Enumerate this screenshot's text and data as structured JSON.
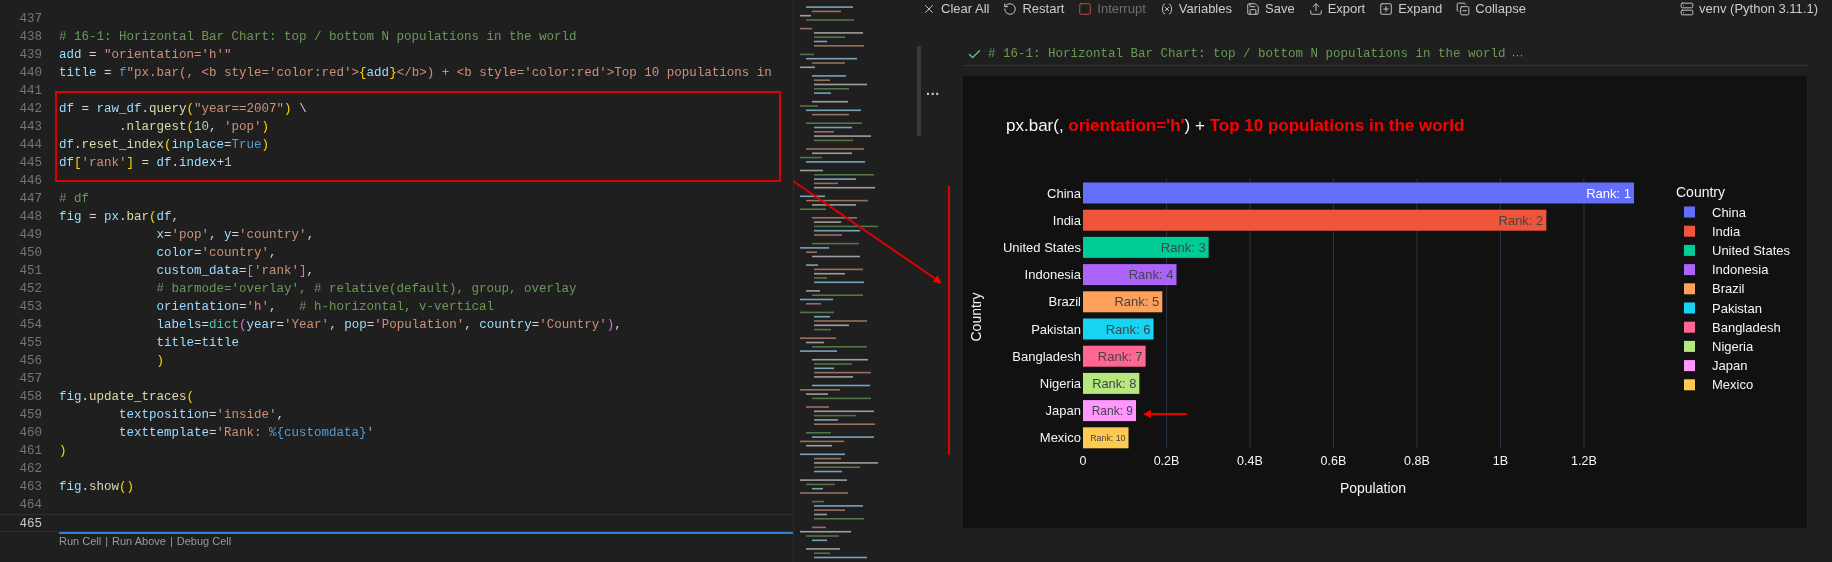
{
  "editor": {
    "lines": [
      {
        "number": "437",
        "current": false
      },
      {
        "number": "438",
        "current": false,
        "tokens": [
          {
            "text": "# 16-1: Horizontal Bar Chart: top / bottom N populations in the world",
            "kind": "comment"
          }
        ]
      },
      {
        "number": "439",
        "current": false,
        "tokens": [
          {
            "text": "add",
            "kind": "name"
          },
          {
            "text": " = ",
            "kind": "punct"
          },
          {
            "text": "\"orientation='h'\"",
            "kind": "string"
          }
        ]
      },
      {
        "number": "440",
        "current": false,
        "tokens": [
          {
            "text": "title",
            "kind": "name"
          },
          {
            "text": " = ",
            "kind": "punct"
          },
          {
            "text": "f",
            "kind": "const"
          },
          {
            "text": "\"px.bar(, <b style='color:red'>",
            "kind": "string"
          },
          {
            "text": "{",
            "kind": "bracket"
          },
          {
            "text": "add",
            "kind": "name"
          },
          {
            "text": "}",
            "kind": "bracket"
          },
          {
            "text": "</b>) + <b style='color:red'>Top 10 populations in",
            "kind": "string"
          }
        ]
      },
      {
        "number": "441",
        "current": false
      },
      {
        "number": "442",
        "current": false,
        "tokens": [
          {
            "text": "df",
            "kind": "name"
          },
          {
            "text": " = ",
            "kind": "punct"
          },
          {
            "text": "raw_df",
            "kind": "name"
          },
          {
            "text": ".",
            "kind": "punct"
          },
          {
            "text": "query",
            "kind": "func"
          },
          {
            "text": "(",
            "kind": "bracket"
          },
          {
            "text": "\"year==2007\"",
            "kind": "string"
          },
          {
            "text": ")",
            "kind": "bracket"
          },
          {
            "text": " \\",
            "kind": "punct"
          }
        ]
      },
      {
        "number": "443",
        "current": false,
        "tokens": [
          {
            "text": "        .",
            "kind": "punct"
          },
          {
            "text": "nlargest",
            "kind": "func"
          },
          {
            "text": "(",
            "kind": "bracket"
          },
          {
            "text": "10",
            "kind": "number"
          },
          {
            "text": ", ",
            "kind": "punct"
          },
          {
            "text": "'pop'",
            "kind": "string"
          },
          {
            "text": ")",
            "kind": "bracket"
          }
        ]
      },
      {
        "number": "444",
        "current": false,
        "tokens": [
          {
            "text": "df",
            "kind": "name"
          },
          {
            "text": ".",
            "kind": "punct"
          },
          {
            "text": "reset_index",
            "kind": "func"
          },
          {
            "text": "(",
            "kind": "bracket"
          },
          {
            "text": "inplace",
            "kind": "name"
          },
          {
            "text": "=",
            "kind": "punct"
          },
          {
            "text": "True",
            "kind": "const"
          },
          {
            "text": ")",
            "kind": "bracket"
          }
        ]
      },
      {
        "number": "445",
        "current": false,
        "tokens": [
          {
            "text": "df",
            "kind": "name"
          },
          {
            "text": "[",
            "kind": "bracket"
          },
          {
            "text": "'rank'",
            "kind": "string"
          },
          {
            "text": "]",
            "kind": "bracket"
          },
          {
            "text": " = ",
            "kind": "punct"
          },
          {
            "text": "df",
            "kind": "name"
          },
          {
            "text": ".",
            "kind": "punct"
          },
          {
            "text": "index",
            "kind": "name"
          },
          {
            "text": "+",
            "kind": "punct"
          },
          {
            "text": "1",
            "kind": "number"
          }
        ]
      },
      {
        "number": "446",
        "current": false
      },
      {
        "number": "447",
        "current": false,
        "tokens": [
          {
            "text": "# df",
            "kind": "comment"
          }
        ]
      },
      {
        "number": "448",
        "current": false,
        "tokens": [
          {
            "text": "fig",
            "kind": "name"
          },
          {
            "text": " = ",
            "kind": "punct"
          },
          {
            "text": "px",
            "kind": "name"
          },
          {
            "text": ".",
            "kind": "punct"
          },
          {
            "text": "bar",
            "kind": "func"
          },
          {
            "text": "(",
            "kind": "bracket"
          },
          {
            "text": "df",
            "kind": "name"
          },
          {
            "text": ",",
            "kind": "punct"
          }
        ]
      },
      {
        "number": "449",
        "current": false,
        "tokens": [
          {
            "text": "             x",
            "kind": "name"
          },
          {
            "text": "=",
            "kind": "punct"
          },
          {
            "text": "'pop'",
            "kind": "string"
          },
          {
            "text": ", ",
            "kind": "punct"
          },
          {
            "text": "y",
            "kind": "name"
          },
          {
            "text": "=",
            "kind": "punct"
          },
          {
            "text": "'country'",
            "kind": "string"
          },
          {
            "text": ",",
            "kind": "punct"
          }
        ]
      },
      {
        "number": "450",
        "current": false,
        "tokens": [
          {
            "text": "             color",
            "kind": "name"
          },
          {
            "text": "=",
            "kind": "punct"
          },
          {
            "text": "'country'",
            "kind": "string"
          },
          {
            "text": ",",
            "kind": "punct"
          }
        ]
      },
      {
        "number": "451",
        "current": false,
        "tokens": [
          {
            "text": "             custom_data",
            "kind": "name"
          },
          {
            "text": "=",
            "kind": "punct"
          },
          {
            "text": "[",
            "kind": "bracket2"
          },
          {
            "text": "'rank'",
            "kind": "string"
          },
          {
            "text": "]",
            "kind": "bracket2"
          },
          {
            "text": ",",
            "kind": "punct"
          }
        ]
      },
      {
        "number": "452",
        "current": false,
        "tokens": [
          {
            "text": "             # barmode='overlay', # relative(default), group, overlay",
            "kind": "comment"
          }
        ]
      },
      {
        "number": "453",
        "current": false,
        "tokens": [
          {
            "text": "             orientation",
            "kind": "name"
          },
          {
            "text": "=",
            "kind": "punct"
          },
          {
            "text": "'h'",
            "kind": "string"
          },
          {
            "text": ",   ",
            "kind": "punct"
          },
          {
            "text": "# h-horizontal, v-vertical",
            "kind": "comment"
          }
        ]
      },
      {
        "number": "454",
        "current": false,
        "tokens": [
          {
            "text": "             labels",
            "kind": "name"
          },
          {
            "text": "=",
            "kind": "punct"
          },
          {
            "text": "dict",
            "kind": "class"
          },
          {
            "text": "(",
            "kind": "bracket2"
          },
          {
            "text": "year",
            "kind": "name"
          },
          {
            "text": "=",
            "kind": "punct"
          },
          {
            "text": "'Year'",
            "kind": "string"
          },
          {
            "text": ", ",
            "kind": "punct"
          },
          {
            "text": "pop",
            "kind": "name"
          },
          {
            "text": "=",
            "kind": "punct"
          },
          {
            "text": "'Population'",
            "kind": "string"
          },
          {
            "text": ", ",
            "kind": "punct"
          },
          {
            "text": "country",
            "kind": "name"
          },
          {
            "text": "=",
            "kind": "punct"
          },
          {
            "text": "'Country'",
            "kind": "string"
          },
          {
            "text": ")",
            "kind": "bracket2"
          },
          {
            "text": ",",
            "kind": "punct"
          }
        ]
      },
      {
        "number": "455",
        "current": false,
        "tokens": [
          {
            "text": "             title",
            "kind": "name"
          },
          {
            "text": "=",
            "kind": "punct"
          },
          {
            "text": "title",
            "kind": "name"
          }
        ]
      },
      {
        "number": "456",
        "current": false,
        "tokens": [
          {
            "text": "             )",
            "kind": "bracket"
          }
        ]
      },
      {
        "number": "457",
        "current": false
      },
      {
        "number": "458",
        "current": false,
        "tokens": [
          {
            "text": "fig",
            "kind": "name"
          },
          {
            "text": ".",
            "kind": "punct"
          },
          {
            "text": "update_traces",
            "kind": "func"
          },
          {
            "text": "(",
            "kind": "bracket"
          }
        ]
      },
      {
        "number": "459",
        "current": false,
        "tokens": [
          {
            "text": "        textposition",
            "kind": "name"
          },
          {
            "text": "=",
            "kind": "punct"
          },
          {
            "text": "'inside'",
            "kind": "string"
          },
          {
            "text": ",",
            "kind": "punct"
          }
        ]
      },
      {
        "number": "460",
        "current": false,
        "tokens": [
          {
            "text": "        texttemplate",
            "kind": "name"
          },
          {
            "text": "=",
            "kind": "punct"
          },
          {
            "text": "'Rank: ",
            "kind": "string"
          },
          {
            "text": "%{customdata}",
            "kind": "const"
          },
          {
            "text": "'",
            "kind": "string"
          }
        ]
      },
      {
        "number": "461",
        "current": false,
        "tokens": [
          {
            "text": ")",
            "kind": "bracket"
          }
        ]
      },
      {
        "number": "462",
        "current": false
      },
      {
        "number": "463",
        "current": false,
        "tokens": [
          {
            "text": "fig",
            "kind": "name"
          },
          {
            "text": ".",
            "kind": "punct"
          },
          {
            "text": "show",
            "kind": "func"
          },
          {
            "text": "()",
            "kind": "bracket"
          }
        ]
      },
      {
        "number": "464",
        "current": false
      },
      {
        "number": "465",
        "current": true
      }
    ],
    "codelens": {
      "separator": "|",
      "items": [
        "Run Cell",
        "Run Above",
        "Debug Cell"
      ]
    }
  },
  "toolbar": {
    "items": [
      {
        "kind": "clear",
        "label": "Clear All",
        "disabled": false
      },
      {
        "kind": "restart",
        "label": "Restart",
        "disabled": false
      },
      {
        "kind": "interrupt",
        "label": "Interrupt",
        "disabled": true
      },
      {
        "kind": "variables",
        "label": "Variables",
        "disabled": false
      },
      {
        "kind": "save",
        "label": "Save",
        "disabled": false
      },
      {
        "kind": "export",
        "label": "Export",
        "disabled": false
      },
      {
        "kind": "expand",
        "label": "Expand",
        "disabled": false
      },
      {
        "kind": "collapse",
        "label": "Collapse",
        "disabled": false
      }
    ],
    "kernel": "venv (Python 3.11.1)"
  },
  "cell": {
    "header": "# 16-1: Horizontal Bar Chart: top / bottom N populations in the world",
    "more": "···",
    "output_menu": "···"
  },
  "output": {
    "title": [
      {
        "text": "px.bar(, ",
        "highlight": false
      },
      {
        "text": "orientation='h'",
        "highlight": true
      },
      {
        "text": ") + ",
        "highlight": false
      },
      {
        "text": "Top 10 populations in the world",
        "highlight": true
      }
    ],
    "chart_data": {
      "type": "bar",
      "orientation": "h",
      "xlabel": "Population",
      "ylabel": "Country",
      "grid": true,
      "legend": {
        "title": "Country"
      },
      "categories": [
        "China",
        "India",
        "United States",
        "Indonesia",
        "Brazil",
        "Pakistan",
        "Bangladesh",
        "Nigeria",
        "Japan",
        "Mexico"
      ],
      "series": [
        {
          "name": "China",
          "color": "#636efa",
          "values": [
            1320000000,
            null,
            null,
            null,
            null,
            null,
            null,
            null,
            null,
            null
          ]
        },
        {
          "name": "India",
          "color": "#ef553b",
          "values": [
            null,
            1110000000,
            null,
            null,
            null,
            null,
            null,
            null,
            null,
            null
          ]
        },
        {
          "name": "United States",
          "color": "#00cc96",
          "values": [
            null,
            null,
            301000000,
            null,
            null,
            null,
            null,
            null,
            null,
            null
          ]
        },
        {
          "name": "Indonesia",
          "color": "#ab63fa",
          "values": [
            null,
            null,
            null,
            224000000,
            null,
            null,
            null,
            null,
            null,
            null
          ]
        },
        {
          "name": "Brazil",
          "color": "#ffa15a",
          "values": [
            null,
            null,
            null,
            null,
            190000000,
            null,
            null,
            null,
            null,
            null
          ]
        },
        {
          "name": "Pakistan",
          "color": "#19d3f3",
          "values": [
            null,
            null,
            null,
            null,
            null,
            169000000,
            null,
            null,
            null,
            null
          ]
        },
        {
          "name": "Bangladesh",
          "color": "#ff6692",
          "values": [
            null,
            null,
            null,
            null,
            null,
            null,
            150000000,
            null,
            null,
            null
          ]
        },
        {
          "name": "Nigeria",
          "color": "#b6e880",
          "values": [
            null,
            null,
            null,
            null,
            null,
            null,
            null,
            135000000,
            null,
            null
          ]
        },
        {
          "name": "Japan",
          "color": "#ff97ff",
          "values": [
            null,
            null,
            null,
            null,
            null,
            null,
            null,
            null,
            127000000,
            null
          ]
        },
        {
          "name": "Mexico",
          "color": "#fecb52",
          "values": [
            null,
            null,
            null,
            null,
            null,
            null,
            null,
            null,
            null,
            109000000
          ]
        }
      ],
      "xlim": [
        0,
        1320000000
      ],
      "xticks": [
        {
          "value": 0,
          "label": "0"
        },
        {
          "value": 200000000,
          "label": "0.2B"
        },
        {
          "value": 400000000,
          "label": "0.4B"
        },
        {
          "value": 600000000,
          "label": "0.6B"
        },
        {
          "value": 800000000,
          "label": "0.8B"
        },
        {
          "value": 1000000000,
          "label": "1B"
        },
        {
          "value": 1200000000,
          "label": "1.2B"
        }
      ],
      "value_labels": [
        "Rank: 1",
        "Rank: 2",
        "Rank: 3",
        "Rank: 4",
        "Rank: 5",
        "Rank: 6",
        "Rank: 7",
        "Rank: 8",
        "Rank: 9",
        "Rank: 10"
      ]
    }
  }
}
